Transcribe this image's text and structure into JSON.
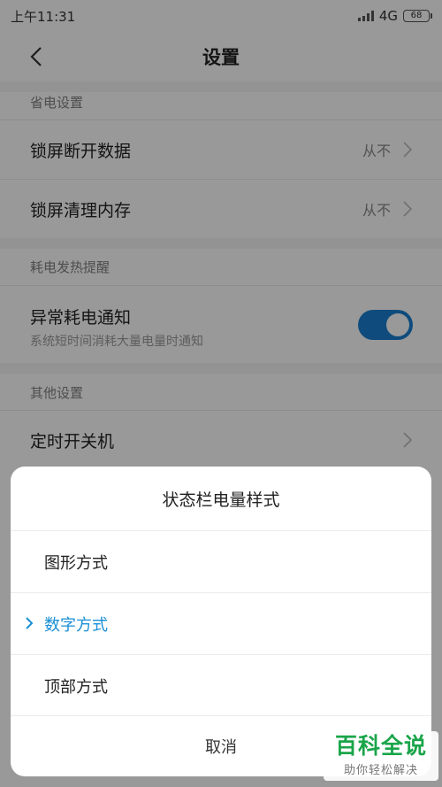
{
  "status_bar": {
    "time": "上午11:31",
    "network": "4G",
    "battery": "68"
  },
  "nav": {
    "title": "设置"
  },
  "sections": {
    "power_saving": {
      "header": "省电设置",
      "rows": [
        {
          "title": "锁屏断开数据",
          "value": "从不"
        },
        {
          "title": "锁屏清理内存",
          "value": "从不"
        }
      ]
    },
    "heat_alert": {
      "header": "耗电发热提醒",
      "row": {
        "title": "异常耗电通知",
        "subtitle": "系统短时间消耗大量电量时通知",
        "toggle_on": true
      }
    },
    "other": {
      "header": "其他设置",
      "row": {
        "title": "定时开关机"
      }
    }
  },
  "dialog": {
    "title": "状态栏电量样式",
    "options": [
      {
        "label": "图形方式",
        "selected": false
      },
      {
        "label": "数字方式",
        "selected": true
      },
      {
        "label": "顶部方式",
        "selected": false
      }
    ],
    "cancel_label": "取消"
  },
  "watermark": {
    "main": "百科全说",
    "sub": "助你轻松解决"
  },
  "colors": {
    "accent": "#1a8fd6",
    "toggle": "#1a7fd0",
    "watermark": "#1aa54a"
  }
}
